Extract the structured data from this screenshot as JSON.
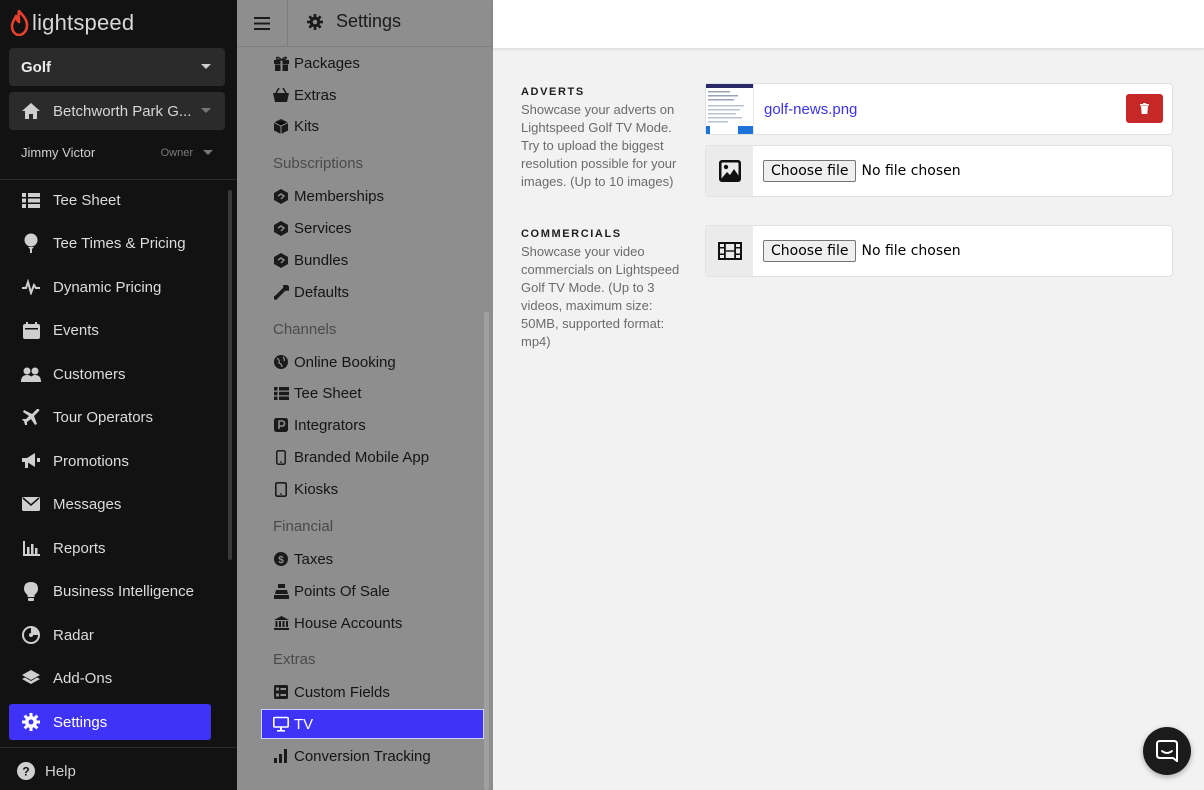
{
  "brand": {
    "name": "lightspeed",
    "accent": "#3f33f7",
    "flame_color": "#e8402f"
  },
  "sidebar": {
    "org_select": "Golf",
    "course_select": "Betchworth Park G...",
    "user_name": "Jimmy Victor",
    "user_role": "Owner",
    "items": [
      {
        "label": "Tee Sheet",
        "icon": "table-icon"
      },
      {
        "label": "Tee Times & Pricing",
        "icon": "golf-ball-tee-icon"
      },
      {
        "label": "Dynamic Pricing",
        "icon": "pulse-icon"
      },
      {
        "label": "Events",
        "icon": "calendar-icon"
      },
      {
        "label": "Customers",
        "icon": "users-icon"
      },
      {
        "label": "Tour Operators",
        "icon": "plane-icon"
      },
      {
        "label": "Promotions",
        "icon": "megaphone-icon"
      },
      {
        "label": "Messages",
        "icon": "envelope-icon"
      },
      {
        "label": "Reports",
        "icon": "bar-chart-icon"
      },
      {
        "label": "Business Intelligence",
        "icon": "lightbulb-icon"
      },
      {
        "label": "Radar",
        "icon": "radar-icon"
      },
      {
        "label": "Add-Ons",
        "icon": "layers-icon"
      },
      {
        "label": "Settings",
        "icon": "gear-icon"
      }
    ],
    "help_label": "Help"
  },
  "settings_menu": {
    "title": "Settings",
    "groups": [
      {
        "heading": "",
        "items": [
          "Packages",
          "Extras",
          "Kits"
        ]
      },
      {
        "heading": "Subscriptions",
        "items": [
          "Memberships",
          "Services",
          "Bundles",
          "Defaults"
        ]
      },
      {
        "heading": "Channels",
        "items": [
          "Online Booking",
          "Tee Sheet",
          "Integrators",
          "Branded Mobile App",
          "Kiosks"
        ]
      },
      {
        "heading": "Financial",
        "items": [
          "Taxes",
          "Points Of Sale",
          "House Accounts"
        ]
      },
      {
        "heading": "Extras",
        "items": [
          "Custom Fields",
          "TV",
          "Conversion Tracking"
        ]
      }
    ],
    "active": "TV"
  },
  "main": {
    "adverts": {
      "heading": "ADVERTS",
      "description": "Showcase your adverts on Lightspeed Golf TV Mode. Try to upload the biggest resolution possible for your images. (Up to 10 images)",
      "uploaded_file": "golf-news.png",
      "choose_label": "Choose file",
      "no_file_label": "No file chosen"
    },
    "commercials": {
      "heading": "COMMERCIALS",
      "description": "Showcase your video commercials on Lightspeed Golf TV Mode. (Up to 3 videos, maximum size: 50MB, supported format: mp4)",
      "choose_label": "Choose file",
      "no_file_label": "No file chosen"
    }
  }
}
